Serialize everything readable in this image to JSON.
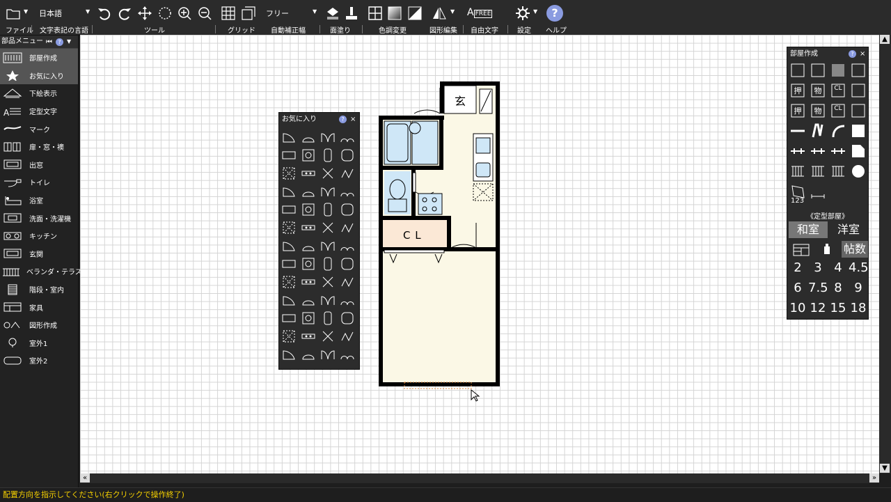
{
  "toolbar": {
    "language": "日本語",
    "snap_mode": "フリー",
    "labels": {
      "file": "ファイル",
      "text_lang": "文字表記の言語",
      "tool": "ツール",
      "grid": "グリッド",
      "auto_correct": "自動補正幅",
      "fill": "面塗り",
      "color_change": "色調変更",
      "shape_edit": "図形編集",
      "free_text": "自由文字",
      "settings": "設定",
      "help": "ヘルプ"
    },
    "free_badge": "FREE"
  },
  "sidebar": {
    "title": "部品メニュー",
    "items": [
      {
        "label": "部屋作成",
        "icon": "room-create-icon"
      },
      {
        "label": "お気に入り",
        "icon": "star-icon"
      },
      {
        "label": "下絵表示",
        "icon": "underlay-icon"
      },
      {
        "label": "定型文字",
        "icon": "fixed-text-icon"
      },
      {
        "label": "マーク",
        "icon": "mark-icon"
      },
      {
        "label": "扉・窓・襖",
        "icon": "door-window-icon"
      },
      {
        "label": "出窓",
        "icon": "bay-window-icon"
      },
      {
        "label": "トイレ",
        "icon": "toilet-icon"
      },
      {
        "label": "浴室",
        "icon": "bath-icon"
      },
      {
        "label": "洗面・洗濯機",
        "icon": "washbasin-icon"
      },
      {
        "label": "キッチン",
        "icon": "kitchen-icon"
      },
      {
        "label": "玄関",
        "icon": "entrance-icon"
      },
      {
        "label": "ベランダ・テラス",
        "icon": "balcony-icon"
      },
      {
        "label": "階段・室内",
        "icon": "stairs-icon"
      },
      {
        "label": "家具",
        "icon": "furniture-icon"
      },
      {
        "label": "図形作成",
        "icon": "shape-create-icon"
      },
      {
        "label": "室外1",
        "icon": "outdoor1-icon"
      },
      {
        "label": "室外2",
        "icon": "outdoor2-icon"
      }
    ]
  },
  "favorites_panel": {
    "title": "お気に入り"
  },
  "room_panel": {
    "title": "部屋作成",
    "closet_labels": [
      "押",
      "物",
      "CL"
    ],
    "counter_label": "123",
    "fixed_room_title": "《定型部屋》",
    "washitsu": "和室",
    "youshitsu": "洋室",
    "tatami": "帖数",
    "numbers": [
      "2",
      "3",
      "4",
      "4.5",
      "6",
      "7.5",
      "8",
      "9",
      "10",
      "12",
      "15",
      "18"
    ]
  },
  "floorplan": {
    "entrance_label": "玄",
    "closet_label": "C L"
  },
  "status": "配置方向を指示してください(右クリックで操作終了)",
  "colors": {
    "accent_help": "#8a9be0",
    "status_text": "#f5d000",
    "floor": "#fbf8e6",
    "bath_blue": "#cfe7f7",
    "closet_fill": "#fbe8d6"
  }
}
